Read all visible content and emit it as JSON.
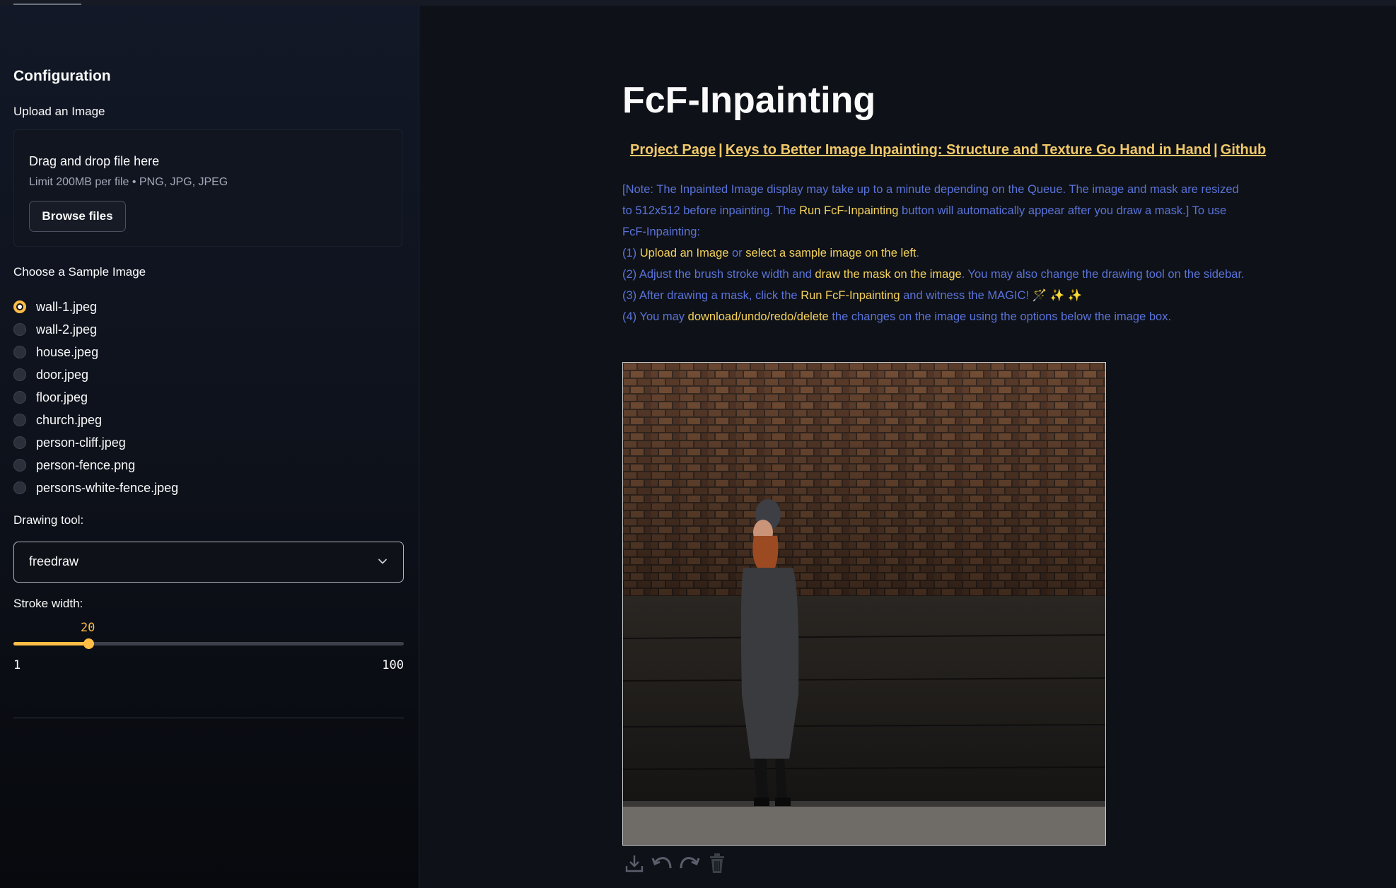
{
  "sidebar": {
    "title": "Configuration",
    "upload": {
      "label": "Upload an Image",
      "drop_title": "Drag and drop file here",
      "drop_sub": "Limit 200MB per file • PNG, JPG, JPEG",
      "browse_label": "Browse files"
    },
    "sample": {
      "label": "Choose a Sample Image",
      "selected": "wall-1.jpeg",
      "options": [
        "wall-1.jpeg",
        "wall-2.jpeg",
        "house.jpeg",
        "door.jpeg",
        "floor.jpeg",
        "church.jpeg",
        "person-cliff.jpeg",
        "person-fence.png",
        "persons-white-fence.jpeg"
      ]
    },
    "drawing_tool": {
      "label": "Drawing tool:",
      "value": "freedraw"
    },
    "stroke": {
      "label": "Stroke width:",
      "value": "20",
      "min": "1",
      "max": "100"
    }
  },
  "main": {
    "title": "FcF-Inpainting",
    "links": {
      "project": "Project Page",
      "sep1": "|",
      "paper": "Keys to Better Image Inpainting: Structure and Texture Go Hand in Hand",
      "sep2": "|",
      "github": "Github"
    },
    "note": {
      "p1a": "[Note: The Inpainted Image display may take up to a minute depending on the Queue. The image and mask are resized to 512x512 before inpainting. The ",
      "p1b": "Run FcF-Inpainting",
      "p1c": " button will automatically appear after you draw a mask.] To use FcF-Inpainting:",
      "s1a": "(1) ",
      "s1b": "Upload an Image",
      "s1c": " or ",
      "s1d": "select a sample image on the left",
      "s1e": ".",
      "s2a": "(2) Adjust the brush stroke width and ",
      "s2b": "draw the mask on the image",
      "s2c": ". You may also change the drawing tool on the sidebar.",
      "s3a": "(3) After drawing a mask, click the ",
      "s3b": "Run FcF-Inpainting",
      "s3c": " and witness the MAGIC! 🪄 ✨ ✨",
      "s4a": "(4) You may ",
      "s4b": "download/undo/redo/delete",
      "s4c": " the changes on the image using the options below the image box."
    },
    "toolbar_icons": [
      "download-icon",
      "undo-icon",
      "redo-icon",
      "trash-icon"
    ]
  },
  "colors": {
    "accent": "#ffbd45",
    "link": "#f0c869",
    "instruction": "#5a73d9",
    "highlight": "#f4d15c"
  }
}
